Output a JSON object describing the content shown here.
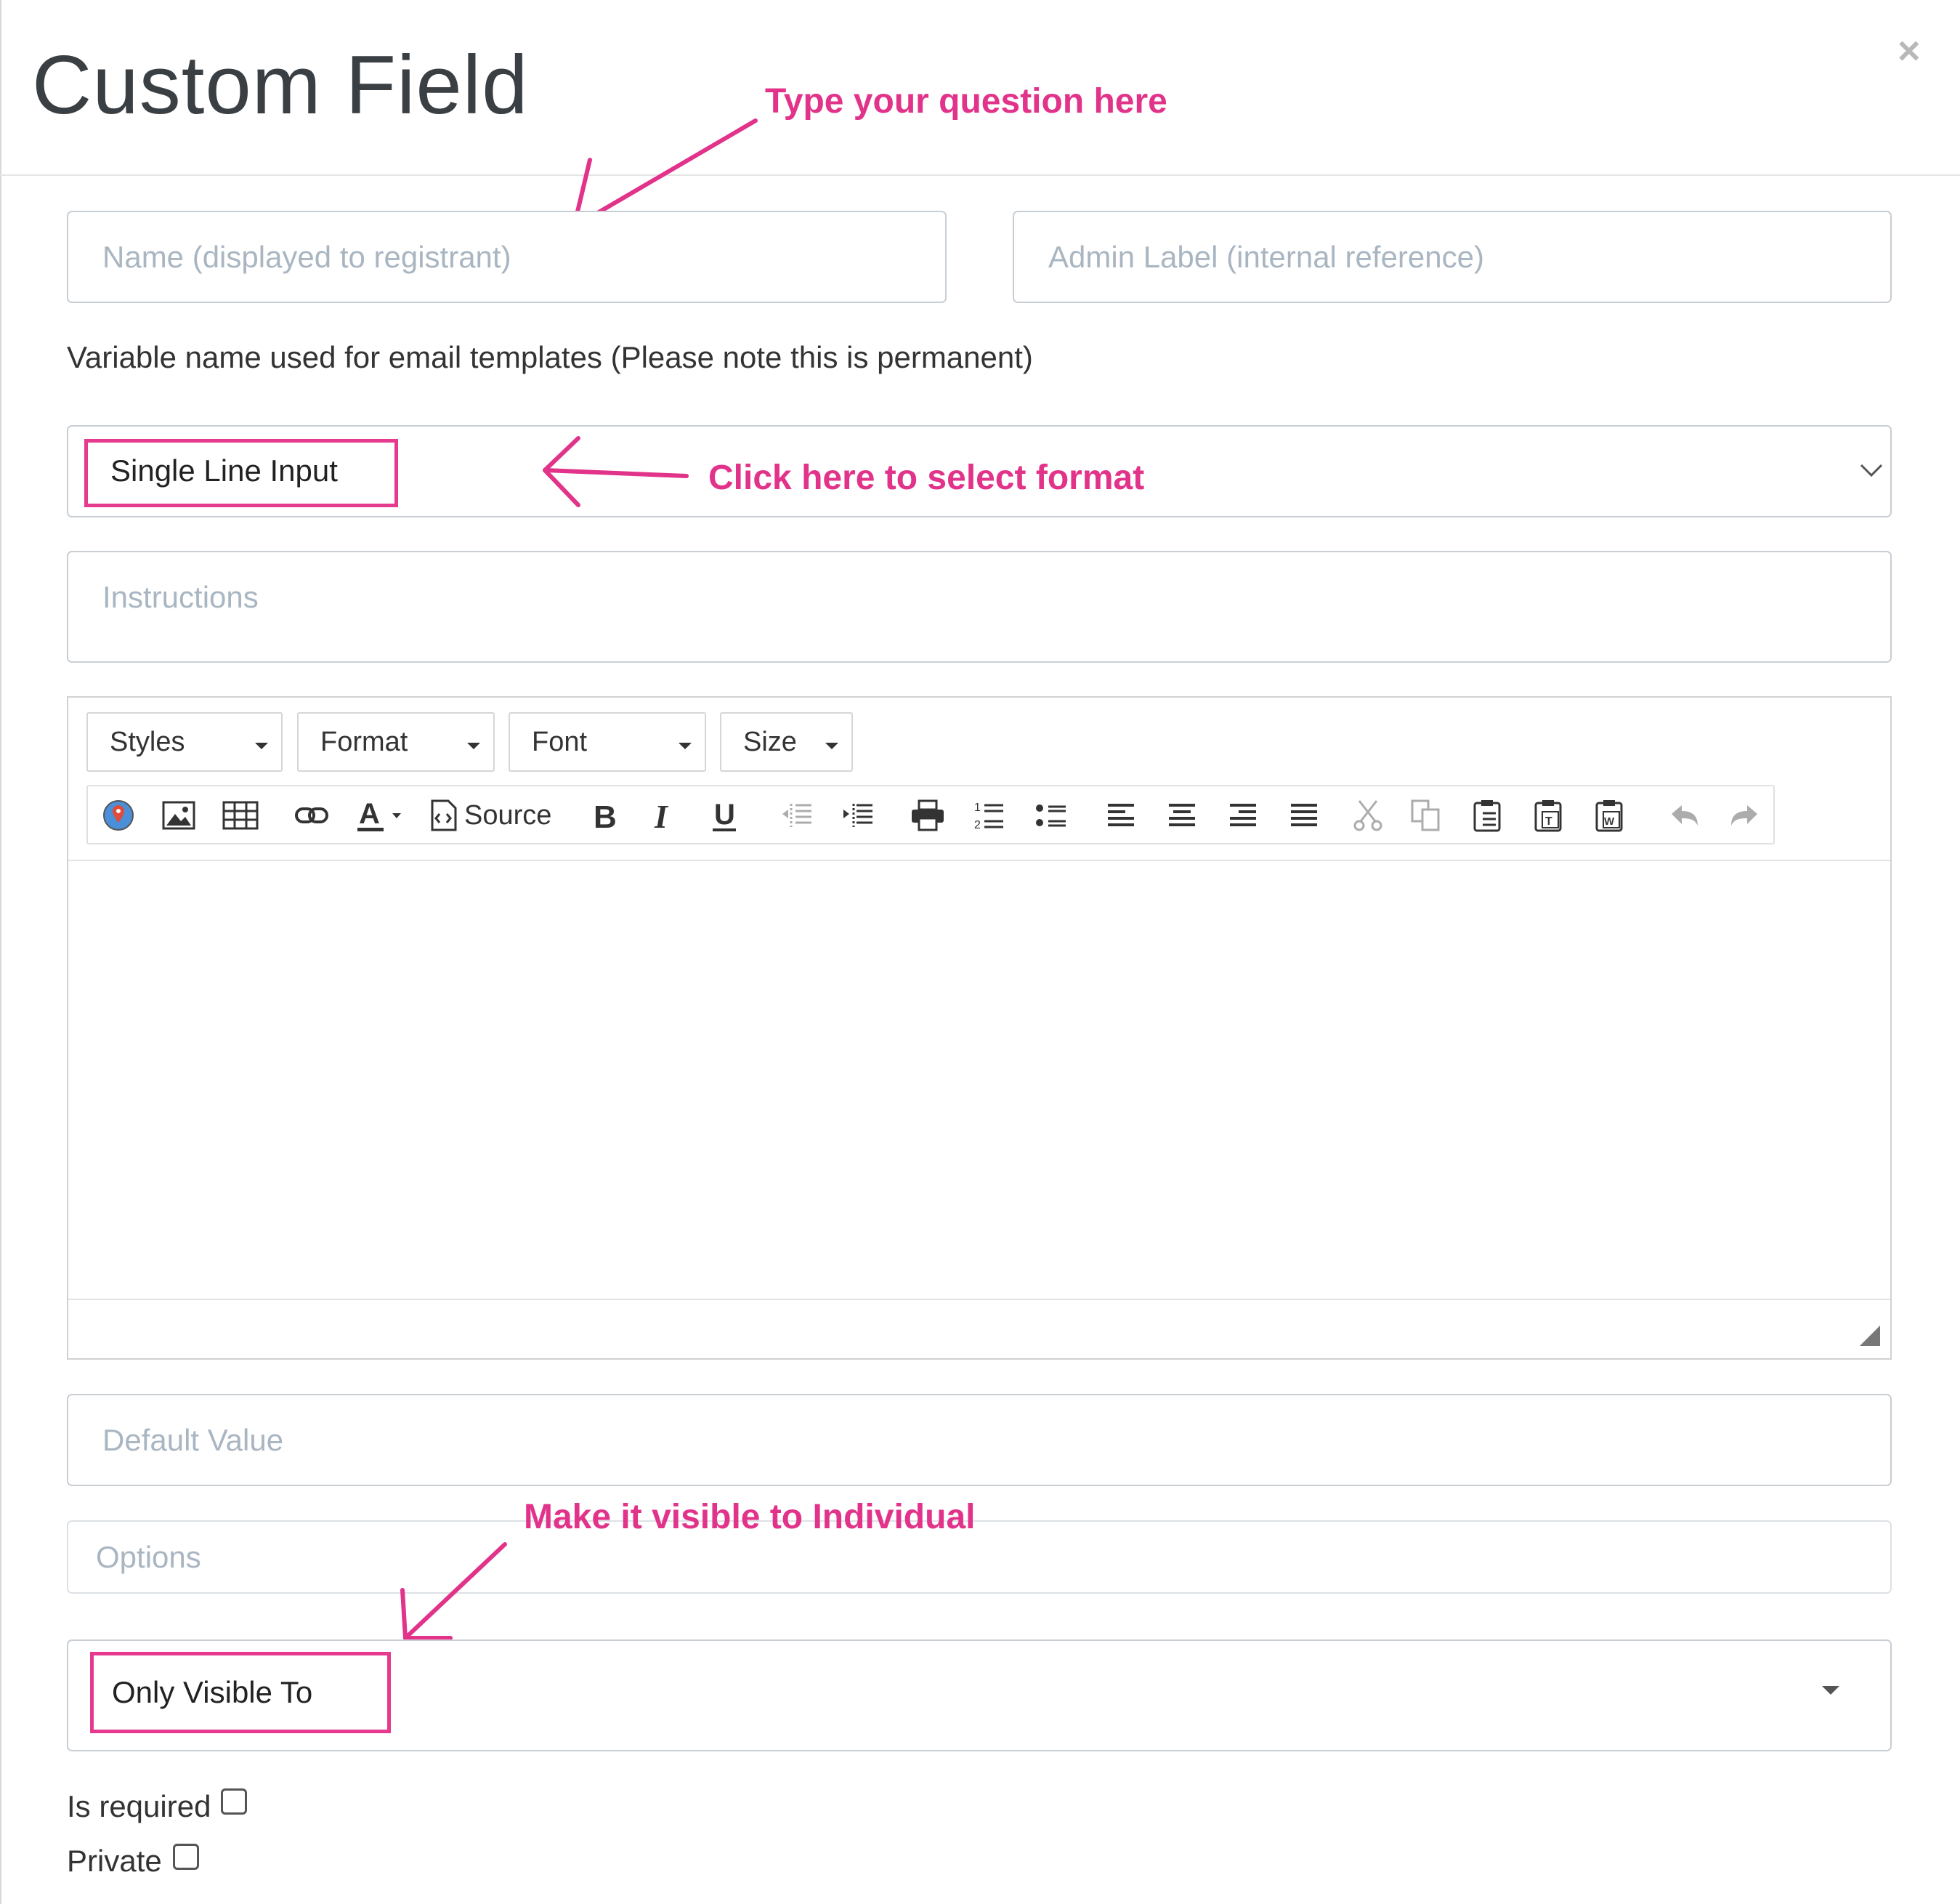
{
  "modal": {
    "title": "Custom Field",
    "close_glyph": "×"
  },
  "fields": {
    "name_placeholder": "Name (displayed to registrant)",
    "admin_label_placeholder": "Admin Label (internal reference)",
    "variable_note": "Variable name used for email templates (Please note this is permanent)",
    "format_value": "Single Line Input",
    "instructions_placeholder": "Instructions",
    "default_value_placeholder": "Default Value",
    "options_placeholder": "Options",
    "visible_to_value": "Only Visible To",
    "is_required_label": "Is required",
    "private_label": "Private"
  },
  "editor": {
    "combos": [
      "Styles",
      "Format",
      "Font",
      "Size"
    ],
    "source_label": "Source"
  },
  "annotations": {
    "question": "Type your question here",
    "format": "Click here to select format",
    "visible": "Make it visible to Individual"
  },
  "colors": {
    "annotation": "#e2338a",
    "placeholder": "#a9b6c2",
    "border": "#c9ced4"
  },
  "icons": [
    "map-icon",
    "image-icon",
    "table-icon",
    "link-icon",
    "text-color-icon",
    "source-icon",
    "bold-icon",
    "italic-icon",
    "underline-icon",
    "outdent-icon",
    "indent-icon",
    "print-icon",
    "numbered-list-icon",
    "bulleted-list-icon",
    "align-left-icon",
    "align-center-icon",
    "align-right-icon",
    "justify-icon",
    "cut-icon",
    "copy-icon",
    "paste-icon",
    "paste-text-icon",
    "paste-word-icon",
    "undo-icon",
    "redo-icon"
  ]
}
